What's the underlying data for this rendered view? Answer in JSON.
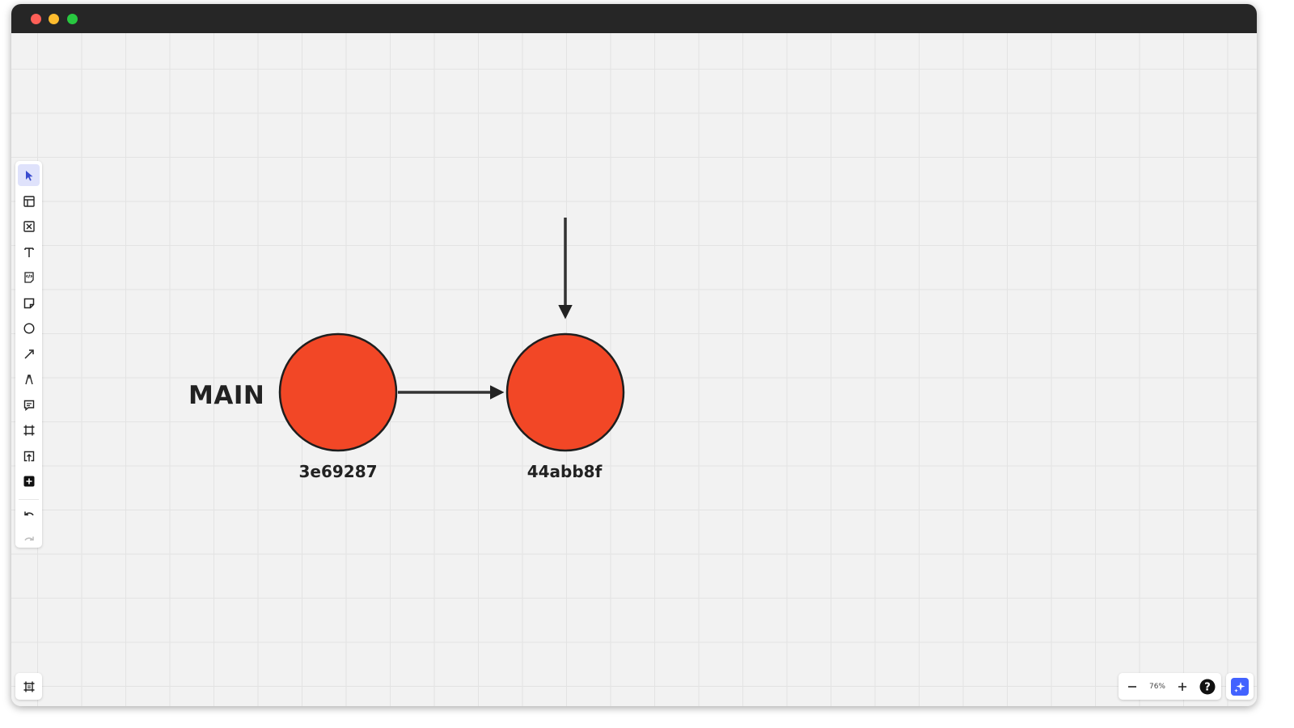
{
  "window": {
    "traffic_lights": {
      "close": "#fe5f57",
      "minimize": "#febc2e",
      "maximize": "#28c840"
    }
  },
  "colors": {
    "commit_fill": "#f24726",
    "stroke": "#222222",
    "accent": "#4262ff",
    "active_tool_bg": "#dfe2fb"
  },
  "toolbar": {
    "tools": [
      {
        "name": "select",
        "icon": "cursor-icon",
        "active": true
      },
      {
        "name": "templates",
        "icon": "templates-icon"
      },
      {
        "name": "frame-placeholder",
        "icon": "image-placeholder-icon"
      },
      {
        "name": "text",
        "icon": "text-icon"
      },
      {
        "name": "embed",
        "icon": "embed-icon"
      },
      {
        "name": "sticky-note",
        "icon": "sticky-note-icon"
      },
      {
        "name": "shapes",
        "icon": "circle-icon"
      },
      {
        "name": "connection-line",
        "icon": "arrow-line-icon"
      },
      {
        "name": "pen",
        "icon": "pen-icon"
      },
      {
        "name": "comment",
        "icon": "comment-icon"
      },
      {
        "name": "frame",
        "icon": "frame-icon"
      },
      {
        "name": "upload",
        "icon": "upload-icon"
      },
      {
        "name": "more-apps",
        "icon": "plus-square-icon"
      }
    ],
    "undo_icon": "undo-icon",
    "redo_icon": "redo-icon"
  },
  "diagram": {
    "branch_label": "MAIN",
    "commits": [
      {
        "id": "3e69287"
      },
      {
        "id": "44abb8f"
      }
    ]
  },
  "zoom": {
    "minus_icon": "minus-icon",
    "level": "76%",
    "plus_icon": "plus-icon",
    "help_icon": "help-icon"
  },
  "bottom_left": {
    "icon": "frames-panel-icon"
  },
  "ai_button": {
    "icon": "sparkle-icon"
  }
}
